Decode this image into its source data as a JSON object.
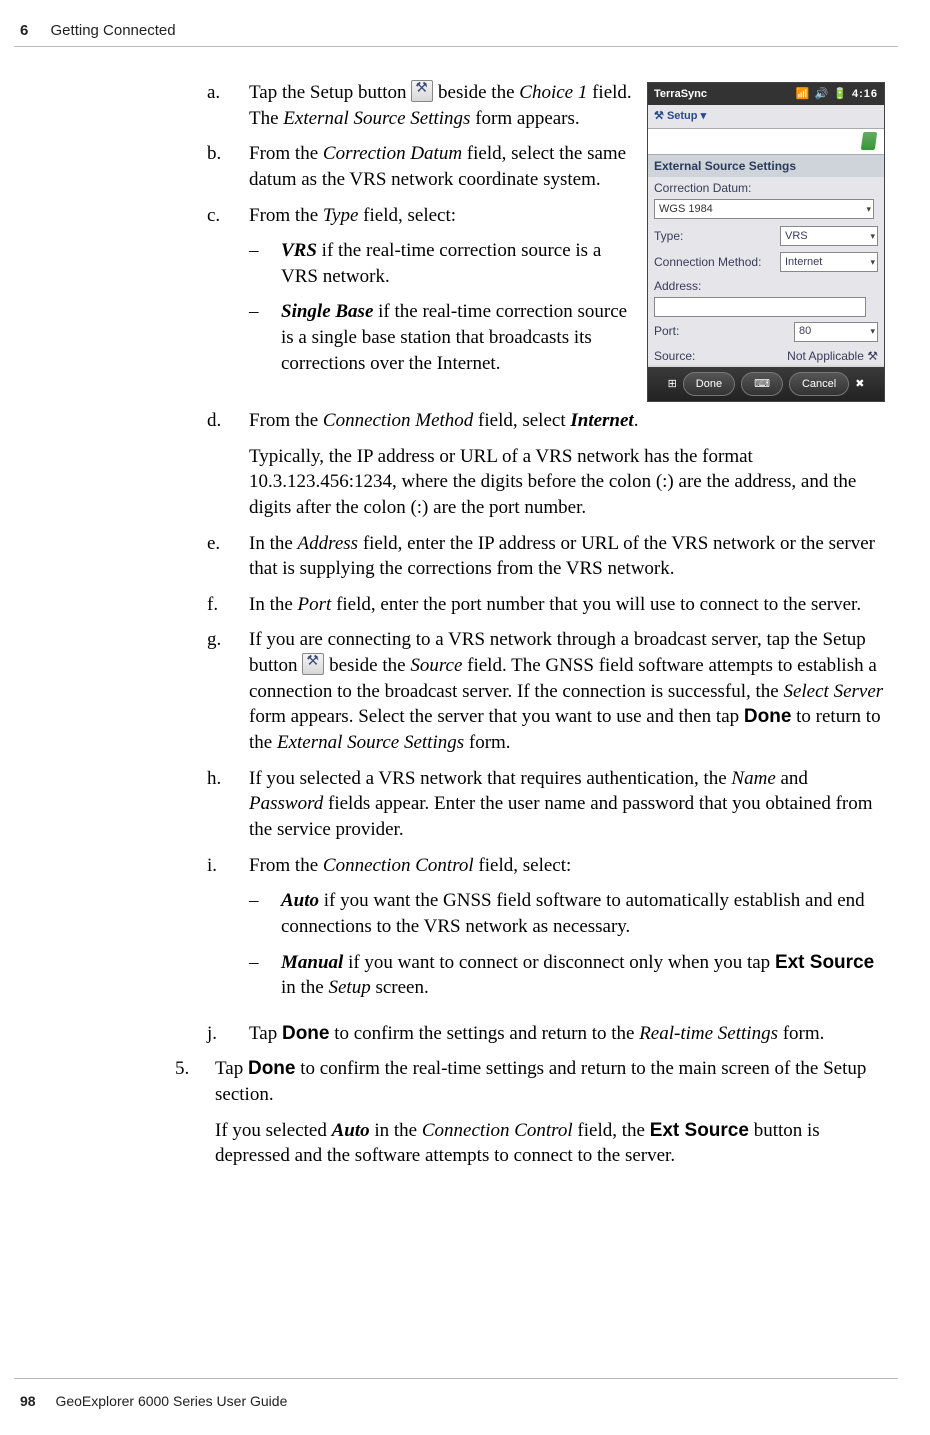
{
  "header": {
    "chapter_number": "6",
    "chapter_title": "Getting Connected"
  },
  "footer": {
    "page_number": "98",
    "book_title": "GeoExplorer 6000 Series User Guide"
  },
  "screenshot": {
    "title": "TerraSync",
    "clock": "4:16",
    "section_btn": "Setup",
    "panel_title": "External Source Settings",
    "rows": {
      "datum_label": "Correction Datum:",
      "datum_value": "WGS 1984",
      "type_label": "Type:",
      "type_value": "VRS",
      "conn_label": "Connection Method:",
      "conn_value": "Internet",
      "addr_label": "Address:",
      "port_label": "Port:",
      "port_value": "80",
      "source_label": "Source:",
      "source_value": "Not Applicable"
    },
    "done_btn": "Done",
    "cancel_btn": "Cancel"
  },
  "steps": {
    "a": {
      "lbl": "a.",
      "pre": "Tap the Setup button ",
      "mid": " beside the ",
      "choice1": "Choice 1",
      "post1": " field. The ",
      "ess": "External Source Settings",
      "post2": " form appears."
    },
    "b": {
      "lbl": "b.",
      "pre": "From the ",
      "field": "Correction Datum",
      "post": " field, select the same datum as the VRS network coordinate system."
    },
    "c": {
      "lbl": "c.",
      "pre": "From the ",
      "field": "Type",
      "post": " field, select:",
      "c1": {
        "dash": "–",
        "term": "VRS",
        "rest": " if the real-time correction source is a VRS network."
      },
      "c2": {
        "dash": "–",
        "term": "Single Base",
        "rest": " if the real-time correction source is a single base station that broadcasts its corrections over the Internet."
      }
    },
    "d": {
      "lbl": "d.",
      "pre": "From the ",
      "field": "Connection Method",
      "mid": " field, select ",
      "val": "Internet",
      "dot": ".",
      "para2": "Typically, the IP address or URL of a VRS network has the format 10.3.123.456:1234, where the digits before the colon (:) are the address, and the digits after the colon (:) are the port number."
    },
    "e": {
      "lbl": "e.",
      "pre": "In the ",
      "field": "Address",
      "post": " field, enter the IP address or URL of the VRS network or the server that is supplying the corrections from the VRS network."
    },
    "f": {
      "lbl": "f.",
      "pre": "In the ",
      "field": "Port",
      "post": " field, enter the port number that you will use to connect to the server."
    },
    "g": {
      "lbl": "g.",
      "pre": "If you are connecting to a VRS network through a broadcast server, tap the Setup button ",
      "mid": " beside the ",
      "src": "Source",
      "post1": " field. The GNSS field software attempts to establish a connection to the broadcast server. If the connection is successful, the ",
      "sel": "Select Server",
      "post2": " form appears. Select the server that you want to use and then tap ",
      "done": "Done",
      "post3": " to return to the ",
      "ess": "External Source Settings",
      "post4": " form."
    },
    "h": {
      "lbl": "h.",
      "pre": "If you selected a VRS network that requires authentication, the ",
      "name": "Name",
      "and": " and ",
      "pwd": "Password",
      "post": " fields appear. Enter the user name and password that you obtained from the service provider."
    },
    "i": {
      "lbl": "i.",
      "pre": "From the ",
      "field": "Connection Control",
      "post": " field, select:",
      "i1": {
        "dash": "–",
        "term": "Auto",
        "rest": " if you want the GNSS field software to automatically establish and end connections to the VRS network as necessary."
      },
      "i2": {
        "dash": "–",
        "term": "Manual",
        "rest_a": " if you want to connect or disconnect only when you tap ",
        "ext": "Ext Source",
        "rest_b": " in the ",
        "setup": "Setup",
        "rest_c": " screen."
      }
    },
    "j": {
      "lbl": "j.",
      "pre": "Tap ",
      "done": "Done",
      "mid": " to confirm the settings and return to the ",
      "form": "Real-time Settings",
      "post": " form."
    }
  },
  "step5": {
    "lbl": "5.",
    "p1a": "Tap ",
    "done": "Done",
    "p1b": " to confirm the real-time settings and return to the main screen of the Setup section.",
    "p2a": "If you selected ",
    "auto": "Auto",
    "p2b": " in the ",
    "cc": "Connection Control",
    "p2c": " field, the ",
    "ext": "Ext Source",
    "p2d": " button is depressed and the software attempts to connect to the server."
  }
}
